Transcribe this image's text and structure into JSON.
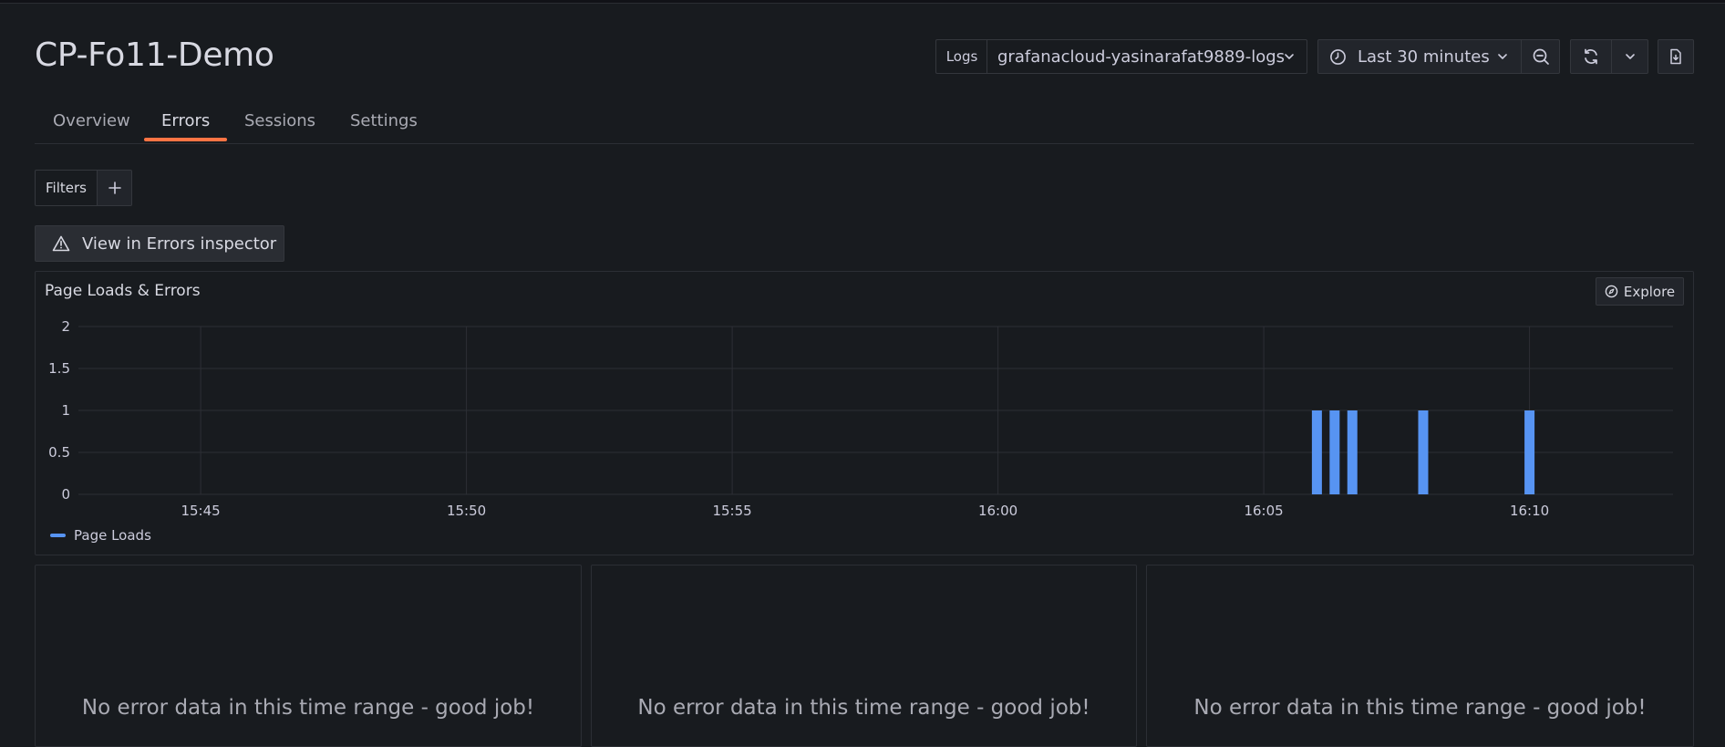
{
  "app": {
    "title": "CP-Fo11-Demo"
  },
  "header": {
    "datasource_label": "Logs",
    "datasource_value": "grafanacloud-yasinarafat9889-logs",
    "time_range": "Last 30 minutes",
    "icons": {
      "datasource_dropdown": "chevron-down-icon",
      "time": "clock-icon",
      "time_dropdown": "chevron-down-icon",
      "zoom": "zoom-out-icon",
      "refresh": "refresh-icon",
      "refresh_more": "chevron-down-icon",
      "export": "export-file-icon"
    }
  },
  "tabs": [
    {
      "label": "Overview",
      "active": false
    },
    {
      "label": "Errors",
      "active": true
    },
    {
      "label": "Sessions",
      "active": false
    },
    {
      "label": "Settings",
      "active": false
    }
  ],
  "filters": {
    "label": "Filters",
    "add_icon": "plus-icon"
  },
  "inspector_button": {
    "label": "View in Errors inspector",
    "icon": "warning-triangle-icon"
  },
  "chart_panel": {
    "title": "Page Loads & Errors",
    "explore_label": "Explore",
    "explore_icon": "compass-icon"
  },
  "chart_data": {
    "type": "bar",
    "title": "Page Loads & Errors",
    "xlabel": "",
    "ylabel": "",
    "y_ticks": [
      "0",
      "0.5",
      "1",
      "1.5",
      "2"
    ],
    "ylim": [
      0,
      2
    ],
    "x_ticks": [
      "15:45",
      "15:50",
      "15:55",
      "16:00",
      "16:05",
      "16:10"
    ],
    "xlim": [
      "15:42:42",
      "16:12:42"
    ],
    "grid": true,
    "legend": "bottom-left",
    "series": [
      {
        "name": "Page Loads",
        "color": "#5794f2",
        "points": [
          {
            "x": "16:06:00",
            "y": 1
          },
          {
            "x": "16:06:20",
            "y": 1
          },
          {
            "x": "16:06:40",
            "y": 1
          },
          {
            "x": "16:08:00",
            "y": 1
          },
          {
            "x": "16:10:00",
            "y": 1
          }
        ]
      }
    ]
  },
  "error_panels": [
    {
      "message": "No error data in this time range - good job!"
    },
    {
      "message": "No error data in this time range - good job!"
    },
    {
      "message": "No error data in this time range - good job!"
    }
  ],
  "colors": {
    "background": "#181b1f",
    "accent": "#ff7444",
    "series": "#5794f2"
  }
}
